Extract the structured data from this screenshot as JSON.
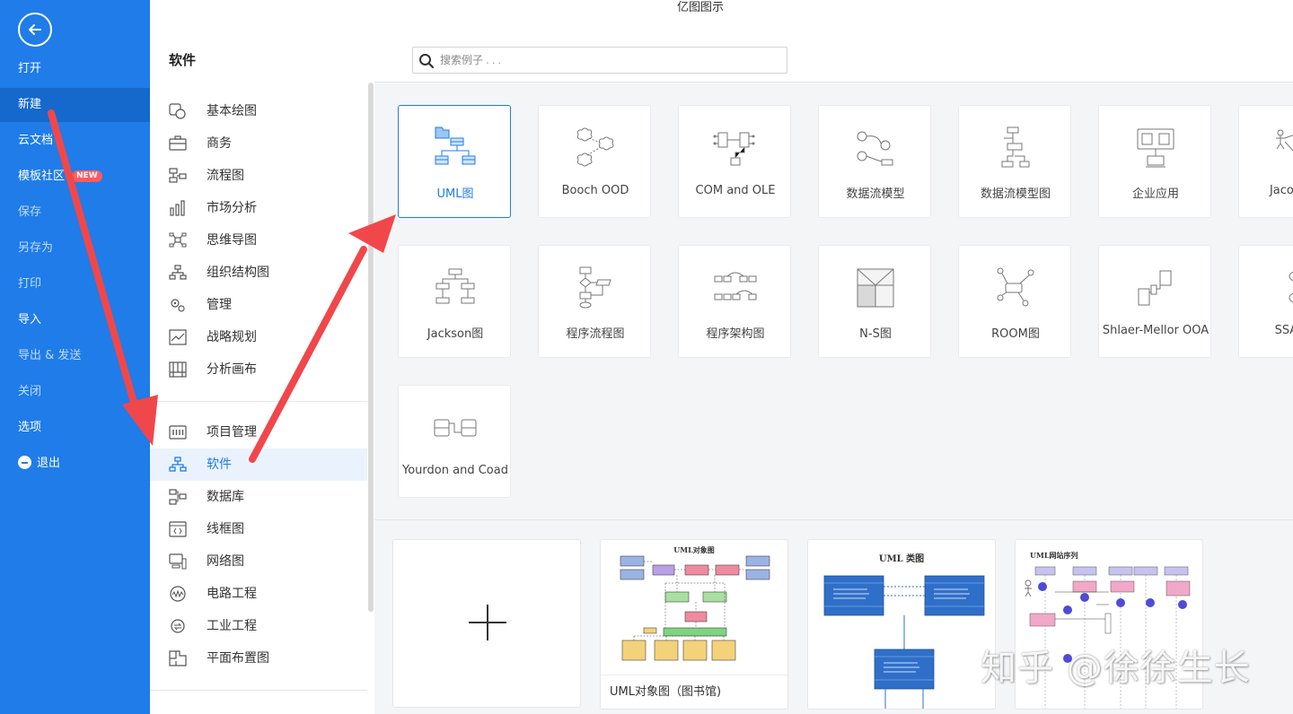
{
  "app_title": "亿图图示",
  "nav": {
    "items": [
      {
        "label": "打开"
      },
      {
        "label": "新建"
      },
      {
        "label": "云文档"
      },
      {
        "label": "模板社区",
        "badge": "NEW"
      },
      {
        "label": "保存"
      },
      {
        "label": "另存为"
      },
      {
        "label": "打印"
      },
      {
        "label": "导入"
      },
      {
        "label": "导出 & 发送"
      },
      {
        "label": "关闭"
      },
      {
        "label": "选项"
      },
      {
        "label": "退出"
      }
    ],
    "active": "新建"
  },
  "categories": {
    "heading": "软件",
    "group1": [
      {
        "label": "基本绘图",
        "icon": "basic-drawing-icon"
      },
      {
        "label": "商务",
        "icon": "briefcase-icon"
      },
      {
        "label": "流程图",
        "icon": "flowchart-icon"
      },
      {
        "label": "市场分析",
        "icon": "bar-chart-icon"
      },
      {
        "label": "思维导图",
        "icon": "mindmap-icon"
      },
      {
        "label": "组织结构图",
        "icon": "org-chart-icon"
      },
      {
        "label": "管理",
        "icon": "gears-icon"
      },
      {
        "label": "战略规划",
        "icon": "line-chart-icon"
      },
      {
        "label": "分析画布",
        "icon": "canvas-grid-icon"
      }
    ],
    "group2": [
      {
        "label": "项目管理",
        "icon": "project-icon"
      },
      {
        "label": "软件",
        "icon": "software-icon"
      },
      {
        "label": "数据库",
        "icon": "database-icon"
      },
      {
        "label": "线框图",
        "icon": "wireframe-icon"
      },
      {
        "label": "网络图",
        "icon": "network-icon"
      },
      {
        "label": "电路工程",
        "icon": "circuit-icon"
      },
      {
        "label": "工业工程",
        "icon": "industrial-icon"
      },
      {
        "label": "平面布置图",
        "icon": "floorplan-icon"
      }
    ],
    "active": "软件"
  },
  "search": {
    "placeholder": "搜索例子 . . ."
  },
  "diagram_types": [
    {
      "label": "UML图"
    },
    {
      "label": "Booch OOD"
    },
    {
      "label": "COM and OLE"
    },
    {
      "label": "数据流模型"
    },
    {
      "label": "数据流模型图"
    },
    {
      "label": "企业应用"
    },
    {
      "label": "Jacobson"
    },
    {
      "label": "Jackson图"
    },
    {
      "label": "程序流程图"
    },
    {
      "label": "程序架构图"
    },
    {
      "label": "N-S图"
    },
    {
      "label": "ROOM图"
    },
    {
      "label": "Shlaer-Mellor OOA"
    },
    {
      "label": "SSADM"
    },
    {
      "label": "Yourdon and Coad"
    }
  ],
  "templates": [
    {
      "caption": "",
      "kind": "new-blank"
    },
    {
      "caption": "UML对象图（图书馆)",
      "title": "UML对象图"
    },
    {
      "caption": "",
      "title": "UML 类图"
    },
    {
      "caption": "",
      "title": "UML网站序列"
    }
  ],
  "watermark": "知乎 @徐徐生长",
  "colors": {
    "accent": "#1f7ce8",
    "annotation_arrow": "#f0474b"
  }
}
